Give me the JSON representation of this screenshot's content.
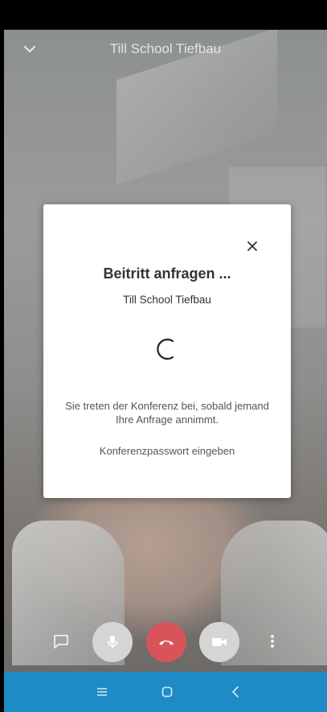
{
  "header": {
    "title": "Till School Tiefbau",
    "collapse_icon": "chevron-down-icon"
  },
  "dialog": {
    "title": "Beitritt anfragen ...",
    "subtitle": "Till School Tiefbau",
    "message": "Sie treten der Konferenz bei, sobald jemand Ihre Anfrage annimmt.",
    "password_link": "Konferenzpasswort eingeben",
    "close_icon": "close-icon",
    "spinner_icon": "loading-spinner-icon"
  },
  "toolbar": {
    "chat_icon": "chat-icon",
    "mic_icon": "microphone-icon",
    "hangup_icon": "hangup-icon",
    "video_icon": "video-camera-icon",
    "more_icon": "more-vertical-icon",
    "mic_bg_color": "#d5d5d5",
    "hangup_bg_color": "#d9535a",
    "video_bg_color": "#d5d5d5"
  },
  "system_nav": {
    "background_color": "#1e8bc6",
    "recent_icon": "recent-apps-icon",
    "home_icon": "home-icon",
    "back_icon": "back-icon"
  }
}
